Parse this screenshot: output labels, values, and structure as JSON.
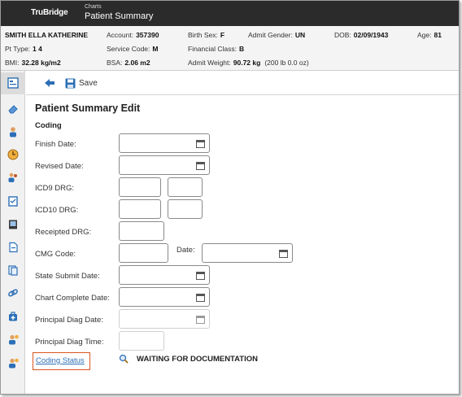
{
  "header": {
    "brand": "TruBridge",
    "breadcrumb_small": "Charts",
    "title": "Patient Summary"
  },
  "patient": {
    "name": "SMITH ELLA KATHERINE",
    "account_label": "Account:",
    "account": "357390",
    "birth_sex_label": "Birth Sex:",
    "birth_sex": "F",
    "admit_gender_label": "Admit Gender:",
    "admit_gender": "UN",
    "dob_label": "DOB:",
    "dob": "02/09/1943",
    "age_label": "Age:",
    "age": "81",
    "pt_type_label": "Pt Type:",
    "pt_type": "1  4",
    "service_code_label": "Service Code:",
    "service_code": "M",
    "financial_class_label": "Financial Class:",
    "financial_class": "B",
    "bmi_label": "BMI:",
    "bmi": "32.28 kg/m2",
    "bsa_label": "BSA:",
    "bsa": "2.06 m2",
    "admit_weight_label": "Admit Weight:",
    "admit_weight": "90.72 kg",
    "admit_weight_alt": "(200 lb 0.0 oz)"
  },
  "toolbar": {
    "save_label": "Save"
  },
  "form": {
    "page_title": "Patient Summary Edit",
    "section_title": "Coding",
    "finish_date_label": "Finish Date:",
    "revised_date_label": "Revised Date:",
    "icd9_drg_label": "ICD9 DRG:",
    "icd10_drg_label": "ICD10 DRG:",
    "receipted_drg_label": "Receipted DRG:",
    "cmg_code_label": "CMG Code:",
    "cmg_date_label": "Date:",
    "state_submit_date_label": "State Submit Date:",
    "chart_complete_date_label": "Chart Complete Date:",
    "principal_diag_date_label": "Principal Diag Date:",
    "principal_diag_time_label": "Principal Diag Time:",
    "coding_status_label": "Coding Status",
    "coding_status_value": "WAITING FOR DOCUMENTATION"
  },
  "icons": {
    "sidebar": [
      "summary-icon",
      "eraser-icon",
      "person-icon",
      "clock-icon",
      "people-icon",
      "clipboard-icon",
      "monitor-icon",
      "document-icon",
      "document-pages-icon",
      "link-icon",
      "medical-bag-icon",
      "person-question-icon",
      "person-question-icon"
    ],
    "accent_blue": "#2c6fb6",
    "highlight_orange": "#d9541e"
  }
}
